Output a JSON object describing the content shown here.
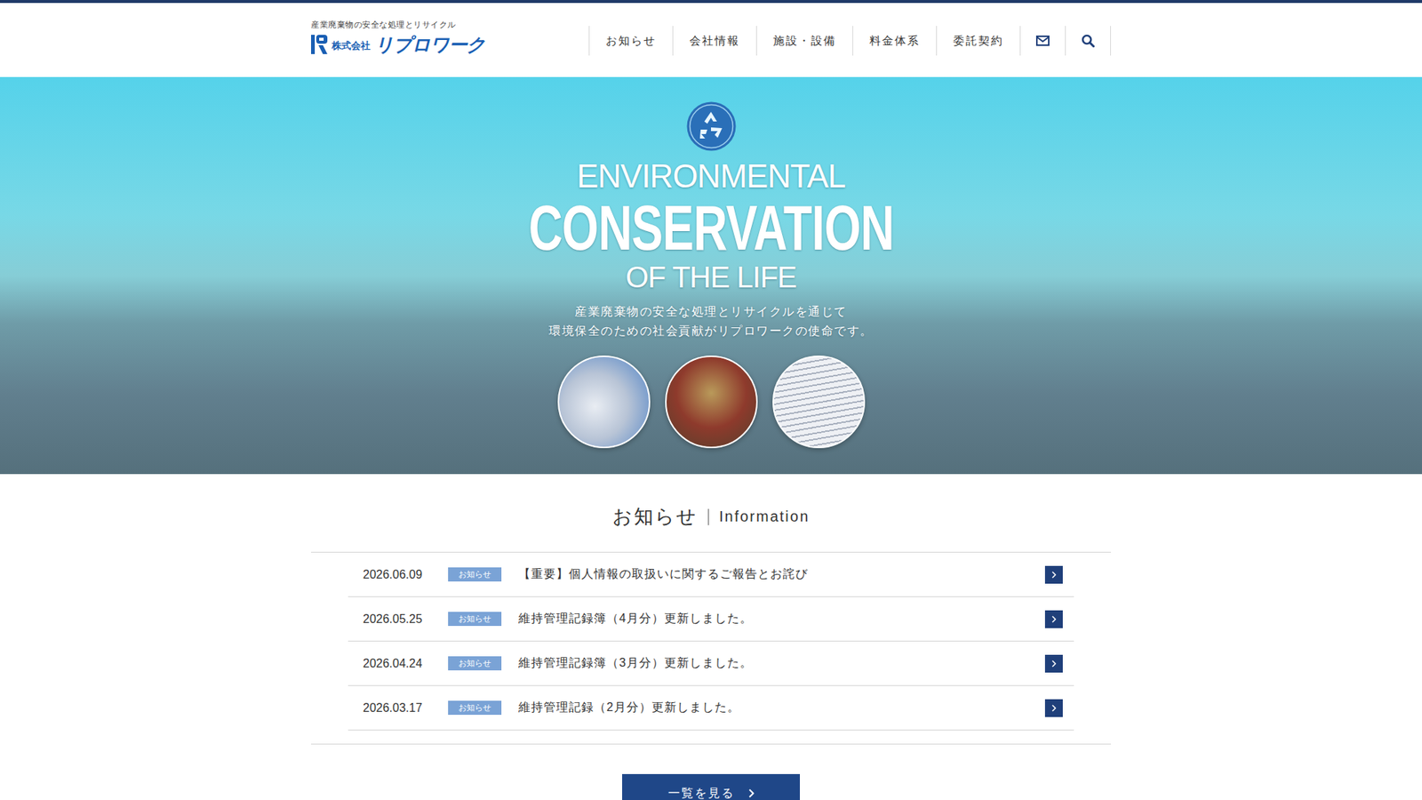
{
  "header": {
    "tagline": "産業廃棄物の安全な処理とリサイクル",
    "logo": {
      "company_type": "株式会社",
      "name": "リプロワーク"
    }
  },
  "nav": [
    {
      "label": "お知らせ"
    },
    {
      "label": "会社情報"
    },
    {
      "label": "施設・設備"
    },
    {
      "label": "料金体系"
    },
    {
      "label": "委託契約"
    }
  ],
  "hero": {
    "title_top": "ENVIRONMENTAL",
    "title_main": "CONSERVATION",
    "title_bottom": "OF THE LIFE",
    "lead": [
      "産業廃棄物の安全な処理とリサイクルを通じて",
      "環境保全のための社会貢献がリプロワークの使命です。"
    ]
  },
  "news": {
    "heading": "お知らせ",
    "subheading": "Information",
    "items": [
      {
        "date": "2026.06.09",
        "category": "お知らせ",
        "title": "【重要】個人情報の取扱いに関するご報告とお詫び"
      },
      {
        "date": "2026.05.25",
        "category": "お知らせ",
        "title": "維持管理記録簿（4月分）更新しました。"
      },
      {
        "date": "2026.04.24",
        "category": "お知らせ",
        "title": "維持管理記録簿（3月分）更新しました。"
      },
      {
        "date": "2026.03.17",
        "category": "お知らせ",
        "title": "維持管理記録（2月分）更新しました。"
      }
    ],
    "more_button": "一覧を見る"
  }
}
